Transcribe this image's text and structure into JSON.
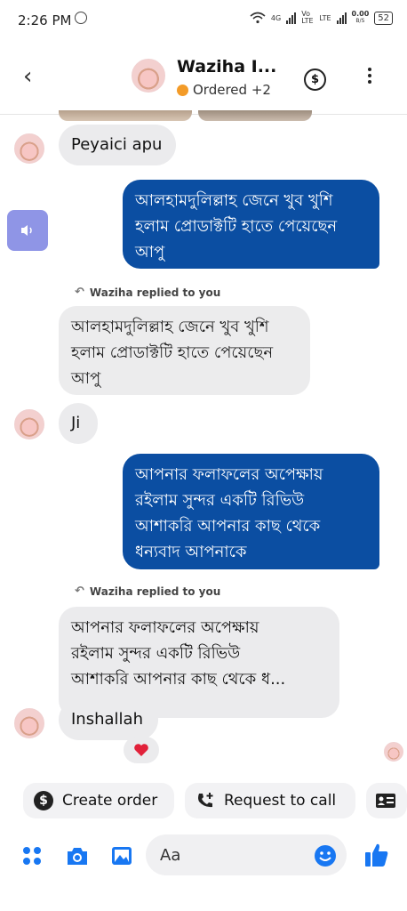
{
  "status_bar": {
    "time": "2:26 PM",
    "network_4g": "4G",
    "volte": "Vo LTE",
    "lte": "LTE",
    "speed_value": "0.00",
    "speed_unit": "B/S",
    "battery": "52"
  },
  "header": {
    "name": "Waziha I...",
    "status": "Ordered +2",
    "status_color": "#f39b28"
  },
  "messages": [
    {
      "side": "in",
      "text": "Peyaici apu"
    },
    {
      "side": "out",
      "lines": [
        "আলহামদুলিল্লাহ জেনে খুব খুশি",
        "হলাম প্রোডাক্টটি হাতে পেয়েছেন",
        "আপু"
      ]
    },
    {
      "reply_note": "Waziha replied to you"
    },
    {
      "side": "in",
      "quoted": true,
      "lines": [
        "আলহামদুলিল্লাহ জেনে খুব খুশি",
        "হলাম প্রোডাক্টটি হাতে পেয়েছেন",
        "আপু"
      ]
    },
    {
      "side": "in",
      "text": "Ji"
    },
    {
      "side": "out",
      "lines": [
        "আপনার ফলাফলের অপেক্ষায়",
        "রইলাম সুন্দর একটি রিভিউ",
        "আশাকরি আপনার কাছ থেকে",
        "ধন্যবাদ আপনাকে"
      ]
    },
    {
      "reply_note": "Waziha replied to you"
    },
    {
      "side": "in",
      "quoted": true,
      "lines": [
        "আপনার ফলাফলের অপেক্ষায়",
        "রইলাম সুন্দর একটি রিভিউ",
        "আশাকরি আপনার কাছ থেকে ধ..."
      ]
    },
    {
      "side": "in",
      "text": "Inshallah",
      "reaction": "heart"
    }
  ],
  "quick_actions": {
    "create_order": "Create order",
    "request_call": "Request to call"
  },
  "composer": {
    "placeholder": "Aa"
  },
  "colors": {
    "outgoing_bubble": "#0b4ea2",
    "incoming_bubble": "#ebebed",
    "accent": "#1877f2"
  },
  "icons": [
    "back-icon",
    "dollar-icon",
    "more-icon",
    "speaker-icon",
    "heart-icon",
    "phone-plus-icon",
    "contact-card-icon",
    "apps-icon",
    "camera-icon",
    "gallery-icon",
    "emoji-icon",
    "like-icon"
  ]
}
